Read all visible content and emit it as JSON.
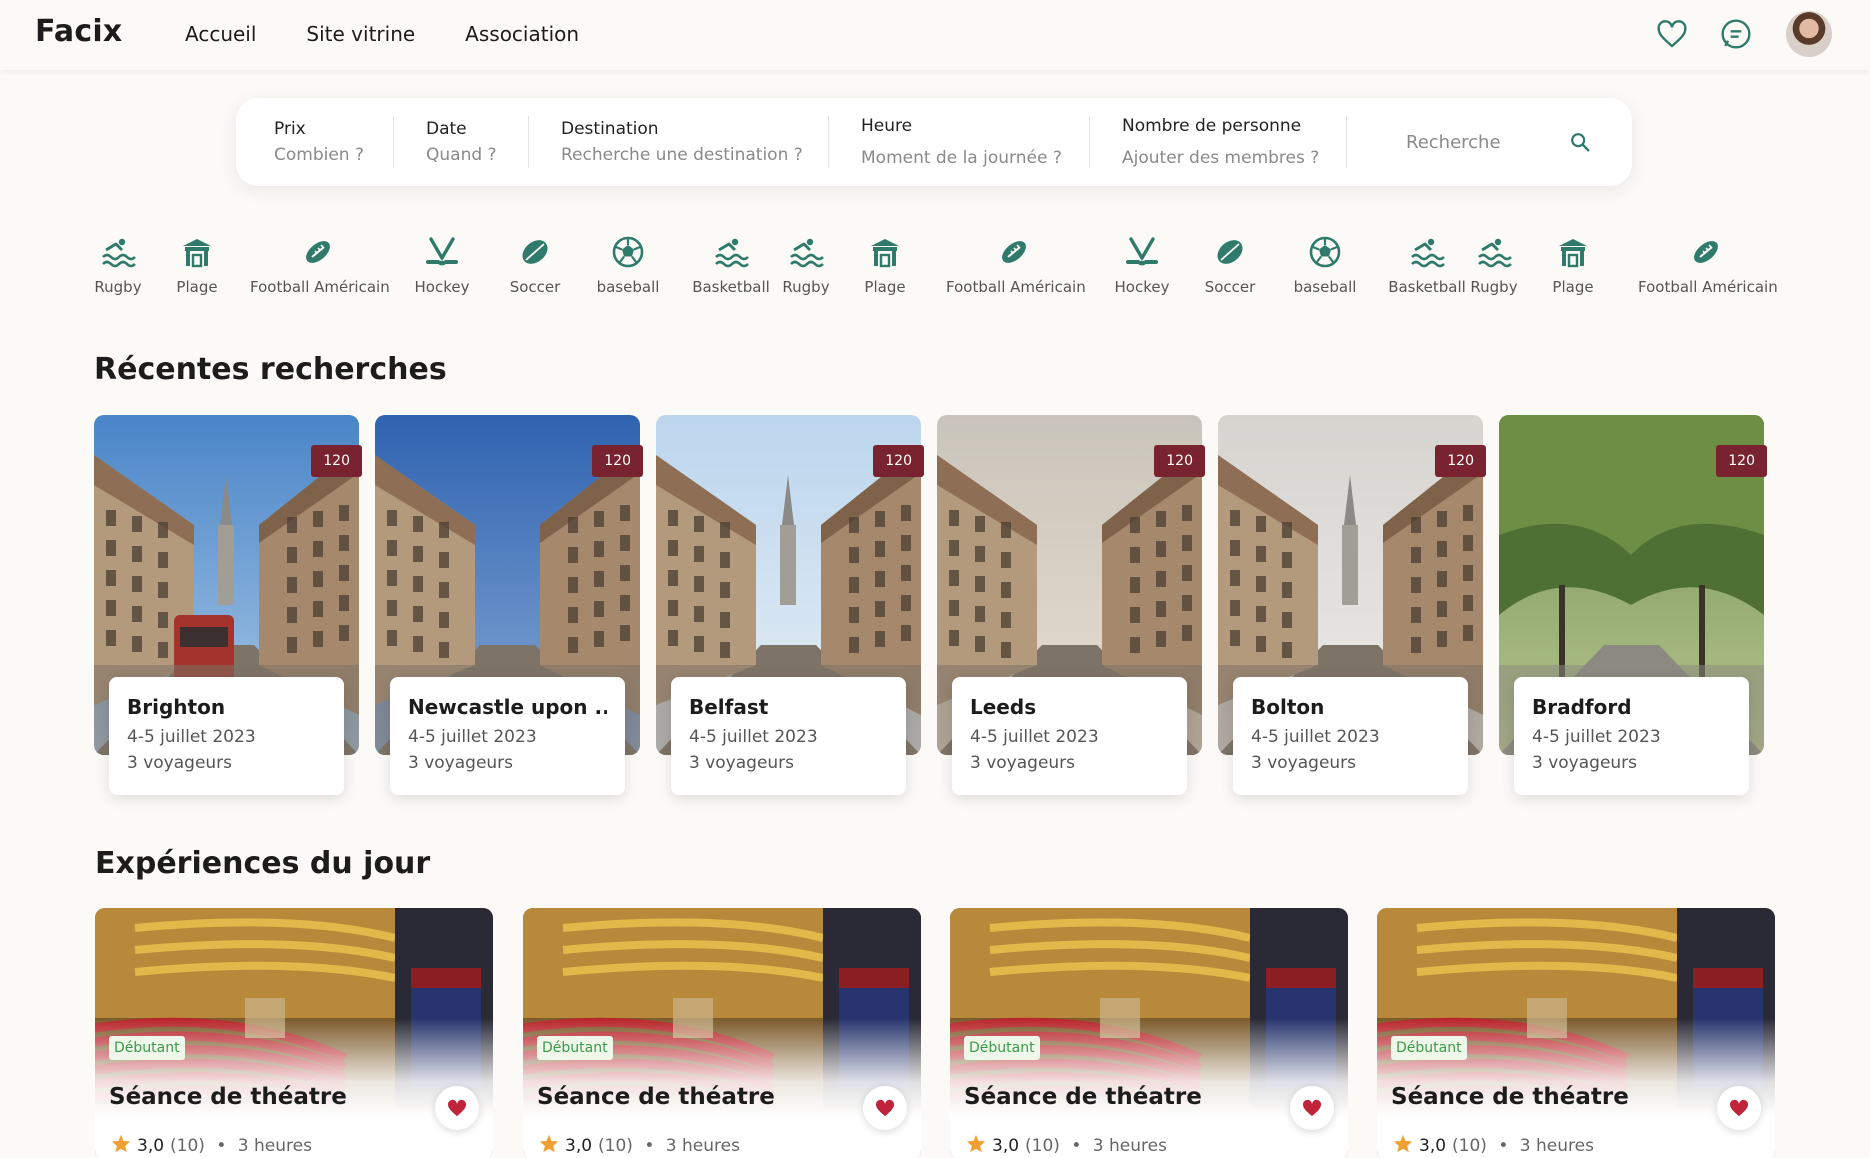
{
  "app": {
    "logo": "Facix"
  },
  "nav": [
    "Accueil",
    "Site vitrine",
    "Association"
  ],
  "search": {
    "fields": [
      {
        "label": "Prix",
        "placeholder": "Combien ?"
      },
      {
        "label": "Date",
        "placeholder": "Quand ?"
      },
      {
        "label": "Destination",
        "placeholder": "Recherche une destination ?"
      },
      {
        "label": "Heure",
        "placeholder": "Moment de la journée ?"
      },
      {
        "label": "Nombre de personne",
        "placeholder": "Ajouter des membres ?"
      }
    ],
    "input_placeholder": "Recherche"
  },
  "categories": [
    {
      "label": "Rugby",
      "icon": "swim-icon"
    },
    {
      "label": "Plage",
      "icon": "beach-hut-icon"
    },
    {
      "label": "Football Américain",
      "icon": "american-football-icon"
    },
    {
      "label": "Hockey",
      "icon": "hockey-icon"
    },
    {
      "label": "Soccer",
      "icon": "ball-icon"
    },
    {
      "label": "baseball",
      "icon": "soccer-ball-icon"
    },
    {
      "label": "Basketball",
      "icon": "swim-icon"
    },
    {
      "label": "Rugby",
      "icon": "swim-icon"
    },
    {
      "label": "Plage",
      "icon": "beach-hut-icon"
    },
    {
      "label": "Football Américain",
      "icon": "american-football-icon"
    },
    {
      "label": "Hockey",
      "icon": "hockey-icon"
    },
    {
      "label": "Soccer",
      "icon": "ball-icon"
    },
    {
      "label": "baseball",
      "icon": "soccer-ball-icon"
    },
    {
      "label": "Basketball",
      "icon": "swim-icon"
    },
    {
      "label": "Rugby",
      "icon": "swim-icon"
    },
    {
      "label": "Plage",
      "icon": "beach-hut-icon"
    },
    {
      "label": "Football Américain",
      "icon": "american-football-icon"
    }
  ],
  "recent": {
    "title": "Récentes recherches",
    "cards": [
      {
        "city": "Brighton",
        "dates": "4-5 juillet 2023",
        "travelers": "3 voyageurs",
        "badge": "120"
      },
      {
        "city": "Newcastle upon ...",
        "dates": "4-5 juillet 2023",
        "travelers": "3 voyageurs",
        "badge": "120"
      },
      {
        "city": "Belfast",
        "dates": "4-5 juillet 2023",
        "travelers": "3 voyageurs",
        "badge": "120"
      },
      {
        "city": "Leeds",
        "dates": "4-5 juillet 2023",
        "travelers": "3 voyageurs",
        "badge": "120"
      },
      {
        "city": "Bolton",
        "dates": "4-5 juillet 2023",
        "travelers": "3 voyageurs",
        "badge": "120"
      },
      {
        "city": "Bradford",
        "dates": "4-5 juillet 2023",
        "travelers": "3 voyageurs",
        "badge": "120"
      }
    ]
  },
  "experiences": {
    "title": "Expériences du jour",
    "cards": [
      {
        "level": "Débutant",
        "title": "Séance de théatre",
        "rating": "3,0",
        "reviews": "(10)",
        "duration": "3 heures"
      },
      {
        "level": "Débutant",
        "title": "Séance de théatre",
        "rating": "3,0",
        "reviews": "(10)",
        "duration": "3 heures"
      },
      {
        "level": "Débutant",
        "title": "Séance de théatre",
        "rating": "3,0",
        "reviews": "(10)",
        "duration": "3 heures"
      },
      {
        "level": "Débutant",
        "title": "Séance de théatre",
        "rating": "3,0",
        "reviews": "(10)",
        "duration": "3 heures"
      }
    ]
  },
  "colors": {
    "badge": "#7a2330",
    "heart": "#c0243a",
    "level_text": "#3d9a4a",
    "icon_teal": "#2f7a6b",
    "star": "#f0a030"
  }
}
